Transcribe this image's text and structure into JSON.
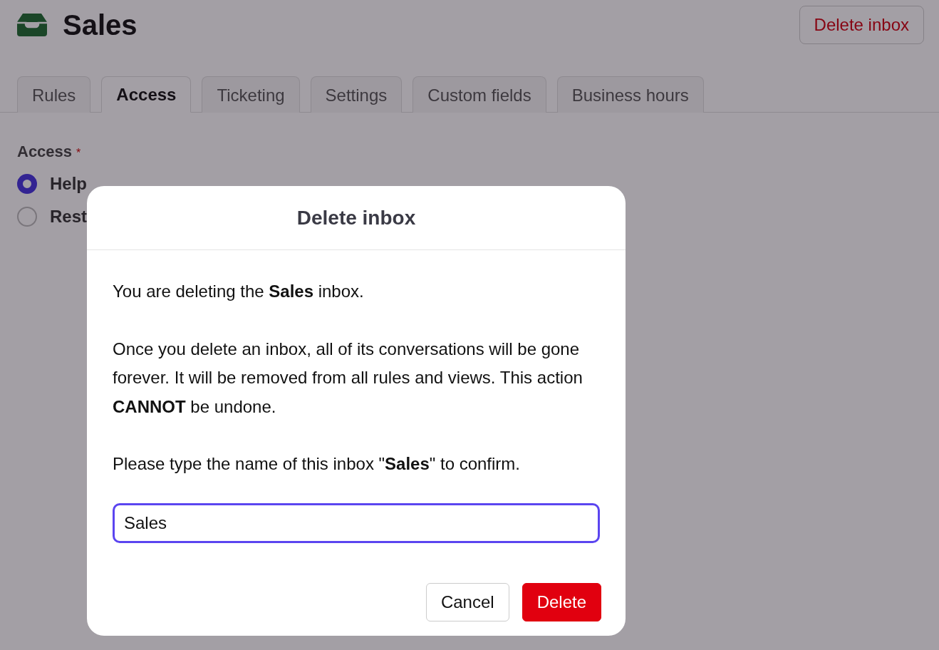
{
  "header": {
    "title": "Sales",
    "delete_button": "Delete inbox"
  },
  "tabs": [
    {
      "label": "Rules",
      "selected": false
    },
    {
      "label": "Access",
      "selected": true
    },
    {
      "label": "Ticketing",
      "selected": false
    },
    {
      "label": "Settings",
      "selected": false
    },
    {
      "label": "Custom fields",
      "selected": false
    },
    {
      "label": "Business hours",
      "selected": false
    }
  ],
  "access": {
    "label": "Access",
    "required_mark": "*",
    "options": [
      {
        "label": "Help",
        "selected": true
      },
      {
        "label": "Rest",
        "selected": false
      }
    ]
  },
  "dialog": {
    "title": "Delete inbox",
    "paragraphs": [
      "You are deleting the **Sales** inbox.",
      "Once you delete an inbox, all of its conversations will be gone forever. It will be removed from all rules and views. This action **CANNOT** be undone.",
      "Please type the name of this inbox \"**Sales**\" to confirm."
    ],
    "input_value": "Sales",
    "cancel": "Cancel",
    "confirm": "Delete"
  }
}
